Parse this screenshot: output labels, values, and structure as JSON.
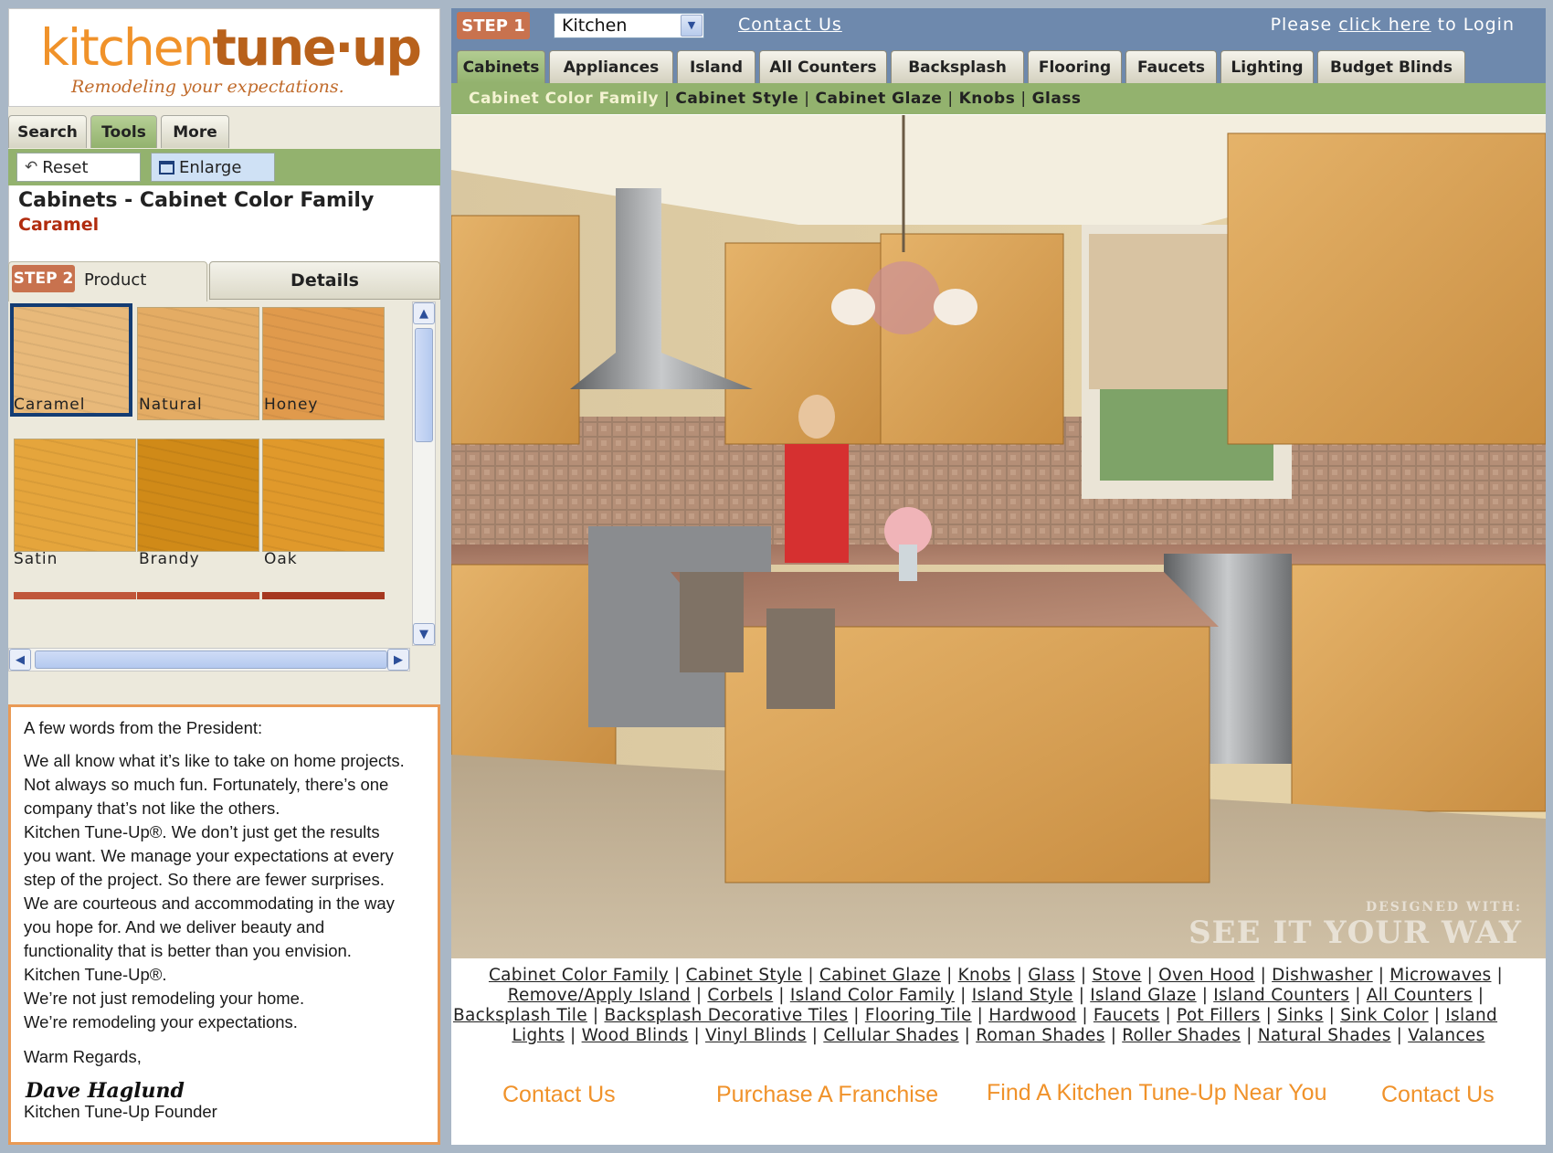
{
  "logo": {
    "brand_part1": "kitchen",
    "brand_part2": "tune·up",
    "tagline": "Remodeling your expectations."
  },
  "left_tabs": [
    "Search",
    "Tools",
    "More"
  ],
  "tools": {
    "reset_label": "Reset",
    "enlarge_label": "Enlarge"
  },
  "selection": {
    "title": "Cabinets - Cabinet Color Family",
    "value": "Caramel"
  },
  "step2": {
    "badge": "STEP 2",
    "product_label": "Product",
    "details_label": "Details"
  },
  "swatches": [
    {
      "name": "Caramel",
      "color": "#e8b97a",
      "selected": true
    },
    {
      "name": "Natural",
      "color": "#e4ac64"
    },
    {
      "name": "Honey",
      "color": "#e09a4c"
    },
    {
      "name": "Satin",
      "color": "#e5a53c"
    },
    {
      "name": "Brandy",
      "color": "#d08a18"
    },
    {
      "name": "Oak",
      "color": "#e0992b"
    }
  ],
  "letter": {
    "heading": "A few words from the President:",
    "body": [
      "We all know what it’s like to take on home projects.",
      "Not always so much fun. Fortunately, there’s one",
      "company that’s not like the others.",
      "Kitchen Tune-Up®. We don’t just get the results",
      "you want. We manage your expectations at every",
      "step of the project. So there are fewer surprises.",
      "We are courteous and accommodating in the way",
      "you hope for. And we deliver beauty and",
      "functionality that is better than you envision.",
      "Kitchen Tune-Up®.",
      "We’re not just remodeling your home.",
      "We’re remodeling your expectations."
    ],
    "closing": "Warm Regards,",
    "signature": "Dave Haglund",
    "signer_title": "Kitchen Tune-Up Founder"
  },
  "top_bar": {
    "step1_badge": "STEP 1",
    "room_selected": "Kitchen",
    "contact_label": "Contact Us",
    "login_prefix": "Please ",
    "login_link": "click here",
    "login_suffix": " to Login"
  },
  "category_tabs": [
    "Cabinets",
    "Appliances",
    "Island",
    "All Counters",
    "Backsplash",
    "Flooring",
    "Faucets",
    "Lighting",
    "Budget Blinds"
  ],
  "active_category": "Cabinets",
  "sub_nav": [
    "Cabinet Color Family",
    "Cabinet Style",
    "Cabinet Glaze",
    "Knobs",
    "Glass"
  ],
  "watermark": {
    "line1": "DESIGNED WITH:",
    "line2": "SEE IT YOUR WAY"
  },
  "bottom_links": [
    [
      "Cabinet Color Family",
      "Cabinet Style",
      "Cabinet Glaze",
      "Knobs",
      "Glass",
      "Stove",
      "Oven Hood",
      "Dishwasher",
      "Microwaves"
    ],
    [
      "Remove/Apply Island",
      "Corbels",
      "Island Color Family",
      "Island Style",
      "Island Glaze",
      "Island Counters",
      "All Counters"
    ],
    [
      "Backsplash Tile",
      "Backsplash Decorative Tiles",
      "Flooring Tile",
      "Hardwood",
      "Faucets",
      "Pot Fillers",
      "Sinks",
      "Sink Color",
      "Island"
    ],
    [
      "Lights",
      "Wood Blinds",
      "Vinyl Blinds",
      "Cellular Shades",
      "Roman Shades",
      "Roller Shades",
      "Natural Shades",
      "Valances"
    ]
  ],
  "footer_links": [
    "Contact Us",
    "Purchase A Franchise",
    "Find A Kitchen Tune-Up Near You",
    "Contact Us"
  ],
  "colors": {
    "accent_orange": "#f0922a",
    "header_blue": "#6e89ad",
    "tab_green": "#93b26e",
    "step_badge": "#c8724e",
    "selection_red": "#b12c0e"
  }
}
